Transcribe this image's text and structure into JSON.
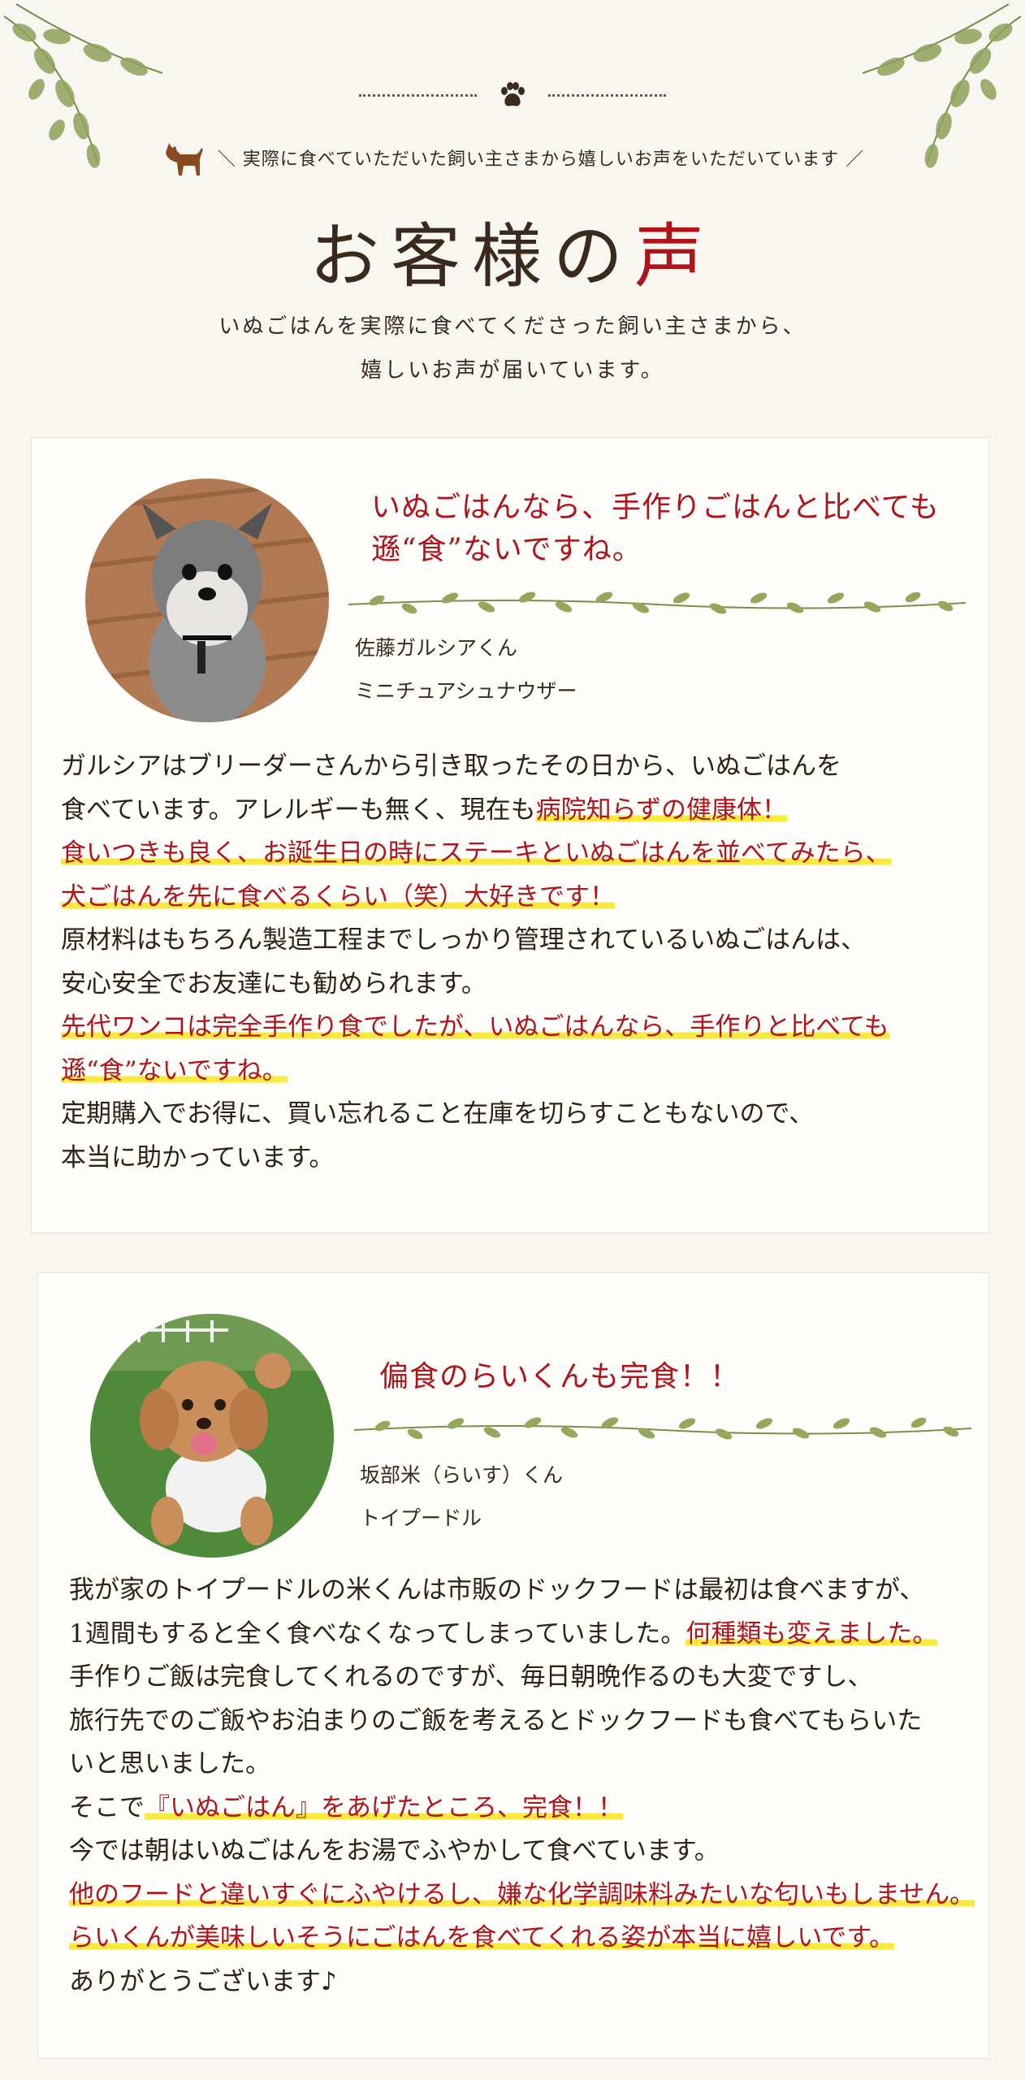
{
  "header": {
    "eyebrow": "＼ 実際に食べていただいた飼い主さまから嬉しいお声をいただいています ／",
    "title_main": "お客様の",
    "title_accent": "声",
    "intro_line1": "いぬごはんを実際に食べてくださった飼い主さまから、",
    "intro_line2": "嬉しいお声が届いています。"
  },
  "testimonials": [
    {
      "headline_line1": "いぬごはんなら、手作りごはんと比べても",
      "headline_line2": "遜“食”ないですね。",
      "dog_name": "佐藤ガルシアくん",
      "breed": "ミニチュアシュナウザー",
      "body": [
        [
          {
            "t": "ガルシアはブリーダーさんから引き取ったその日から、いぬごはんを"
          }
        ],
        [
          {
            "t": "食べています。アレルギーも無く、現在も"
          },
          {
            "t": "病院知らずの健康体！",
            "hl": true
          }
        ],
        [
          {
            "t": "食いつきも良く、お誕生日の時にステーキといぬごはんを並べてみたら、",
            "hl": true
          }
        ],
        [
          {
            "t": "犬ごはんを先に食べるくらい（笑）大好きです！",
            "hl": true
          }
        ],
        [
          {
            "t": "原材料はもちろん製造工程までしっかり管理されているいぬごはんは、"
          }
        ],
        [
          {
            "t": "安心安全でお友達にも勧められます。"
          }
        ],
        [
          {
            "t": "先代ワンコは完全手作り食でしたが、いぬごはんなら、手作りと比べても",
            "hl": true
          }
        ],
        [
          {
            "t": "遜“食”ないですね。",
            "hl": true
          }
        ],
        [
          {
            "t": "定期購入でお得に、買い忘れること在庫を切らすこともないので、"
          }
        ],
        [
          {
            "t": "本当に助かっています。"
          }
        ]
      ]
    },
    {
      "headline_line1": "偏食のらいくんも完食！！",
      "headline_line2": "",
      "dog_name": "坂部米（らいす）くん",
      "breed": "トイプードル",
      "body": [
        [
          {
            "t": "我が家のトイプードルの米くんは市販のドックフードは最初は食べますが、"
          }
        ],
        [
          {
            "t": "1週間もすると全く食べなくなってしまっていました。"
          },
          {
            "t": "何種類も変えました。",
            "hl": true
          }
        ],
        [
          {
            "t": "手作りご飯は完食してくれるのですが、毎日朝晩作るのも大変ですし、"
          }
        ],
        [
          {
            "t": "旅行先でのご飯やお泊まりのご飯を考えるとドックフードも食べてもらいた"
          }
        ],
        [
          {
            "t": "いと思いました。"
          }
        ],
        [
          {
            "t": "そこで"
          },
          {
            "t": "『いぬごはん』をあげたところ、完食！！",
            "hl": true
          }
        ],
        [
          {
            "t": "今では朝はいぬごはんをお湯でふやかして食べています。"
          }
        ],
        [
          {
            "t": "他のフードと違いすぐにふやけるし、嫌な化学調味料みたいな匂いもしません。",
            "hl": true
          }
        ],
        [
          {
            "t": "らいくんが美味しいそうにごはんを食べてくれる姿が本当に嬉しいです。",
            "hl": true
          }
        ],
        [
          {
            "t": "ありがとうございます♪"
          }
        ]
      ]
    }
  ],
  "colors": {
    "accent": "#b0141b",
    "highlight": "#f8ea3c",
    "text": "#3a2a1e",
    "background": "#f8f6f1"
  },
  "icons": [
    "leaves-decoration",
    "paw-icon",
    "dog-silhouette-icon",
    "vine-divider",
    "dog-photo"
  ]
}
